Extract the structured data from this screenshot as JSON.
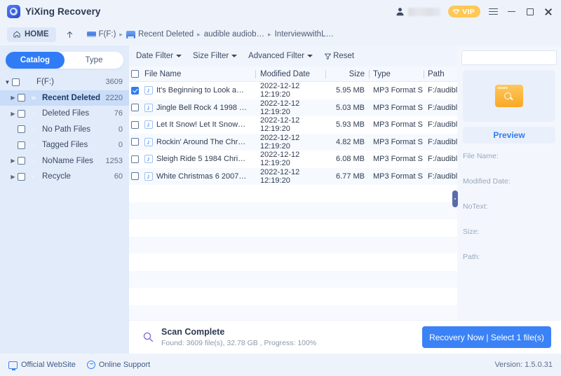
{
  "window": {
    "app_title": "YiXing Recovery",
    "logo_icon": "app-logo-icon",
    "user_icon": "user-avatar-icon",
    "user_name_redacted": "",
    "vip_label": "VIP",
    "vip_icon": "diamond-icon",
    "menu_icon": "hamburger-menu-icon",
    "minimize_icon": "minimize-icon",
    "maximize_icon": "maximize-icon",
    "close_icon": "close-icon"
  },
  "breadcrumb": {
    "home_label": "HOME",
    "home_icon": "home-icon",
    "up_icon": "arrow-up-icon",
    "items": [
      {
        "label": "F(F:)",
        "icon": "drive-icon"
      },
      {
        "label": "Recent Deleted",
        "icon": "folder-icon"
      },
      {
        "label": "audible audiob…",
        "icon": ""
      },
      {
        "label": "InterviewwithL…",
        "icon": ""
      }
    ],
    "separator": "▸"
  },
  "sidebar": {
    "tabs": [
      {
        "label": "Catalog",
        "active": true
      },
      {
        "label": "Type",
        "active": false
      }
    ],
    "tree": [
      {
        "label": "F(F:)",
        "count": "3609",
        "icon": "disk-icon",
        "caret": "open",
        "indent": 0,
        "selected": false,
        "checked": false
      },
      {
        "label": "Recent Deleted",
        "count": "2220",
        "icon": "recent-deleted-icon",
        "caret": "closed",
        "indent": 1,
        "selected": true,
        "checked": false
      },
      {
        "label": "Deleted Files",
        "count": "76",
        "icon": "folder-icon",
        "caret": "closed",
        "indent": 1,
        "selected": false,
        "checked": false
      },
      {
        "label": "No Path Files",
        "count": "0",
        "icon": "folder-icon",
        "caret": "none",
        "indent": 1,
        "selected": false,
        "checked": false
      },
      {
        "label": "Tagged Files",
        "count": "0",
        "icon": "folder-icon",
        "caret": "none",
        "indent": 1,
        "selected": false,
        "checked": false
      },
      {
        "label": "NoName Files",
        "count": "1253",
        "icon": "folder-icon",
        "caret": "closed",
        "indent": 1,
        "selected": false,
        "checked": false
      },
      {
        "label": "Recycle",
        "count": "60",
        "icon": "recycle-bin-icon",
        "caret": "closed",
        "indent": 1,
        "selected": false,
        "checked": false
      }
    ]
  },
  "filters": {
    "date_filter": "Date Filter",
    "size_filter": "Size Filter",
    "advanced_filter": "Advanced Filter",
    "reset": "Reset",
    "reset_icon": "funnel-reset-icon"
  },
  "table": {
    "headers": [
      "File Name",
      "Modified Date",
      "Size",
      "Type",
      "Path"
    ],
    "select_all_checked": false,
    "rows": [
      {
        "checked": true,
        "name": "It's Beginning to Look a…",
        "date": "2022-12-12 12:19:20",
        "size": "5.95 MB",
        "type": "MP3 Format S…",
        "path": "F:/audible audiob…"
      },
      {
        "checked": false,
        "name": "Jingle Bell Rock 4 1998 …",
        "date": "2022-12-12 12:19:20",
        "size": "5.03 MB",
        "type": "MP3 Format S…",
        "path": "F:/audible audiob…"
      },
      {
        "checked": false,
        "name": "Let It Snow! Let It Snow…",
        "date": "2022-12-12 12:19:20",
        "size": "5.93 MB",
        "type": "MP3 Format S…",
        "path": "F:/audible audiob…"
      },
      {
        "checked": false,
        "name": "Rockin' Around The Chr…",
        "date": "2022-12-12 12:19:20",
        "size": "4.82 MB",
        "type": "MP3 Format S…",
        "path": "F:/audible audiob…"
      },
      {
        "checked": false,
        "name": "Sleigh Ride 5 1984 Chri…",
        "date": "2022-12-12 12:19:20",
        "size": "6.08 MB",
        "type": "MP3 Format S…",
        "path": "F:/audible audiob…"
      },
      {
        "checked": false,
        "name": "White Christmas 6 2007…",
        "date": "2022-12-12 12:19:20",
        "size": "6.77 MB",
        "type": "MP3 Format S…",
        "path": "F:/audible audiob…"
      }
    ]
  },
  "preview": {
    "search_value": "",
    "search_placeholder": "",
    "search_icon": "search-icon",
    "thumbnail_icon": "folder-search-icon",
    "preview_button": "Preview",
    "fields": [
      {
        "label": "File Name:"
      },
      {
        "label": "Modified Date:"
      },
      {
        "label": "NoText:"
      },
      {
        "label": "Size:"
      },
      {
        "label": "Path:"
      }
    ]
  },
  "status": {
    "scan_icon": "magnifier-icon",
    "title": "Scan Complete",
    "subtitle": "Found: 3609 file(s), 32.78 GB , Progress: 100%",
    "recovery_button": "Recovery Now | Select 1 file(s)"
  },
  "footer": {
    "website_label": "Official WebSite",
    "website_icon": "monitor-icon",
    "support_label": "Online Support",
    "support_icon": "chat-icon",
    "version": "Version: 1.5.0.31"
  },
  "colors": {
    "accent_blue": "#2f7cf6",
    "button_blue": "#3b82f6",
    "vip_amber": "#ffc757",
    "panel_blue": "#e2ebfa",
    "chrome_blue": "#eef3fb"
  }
}
